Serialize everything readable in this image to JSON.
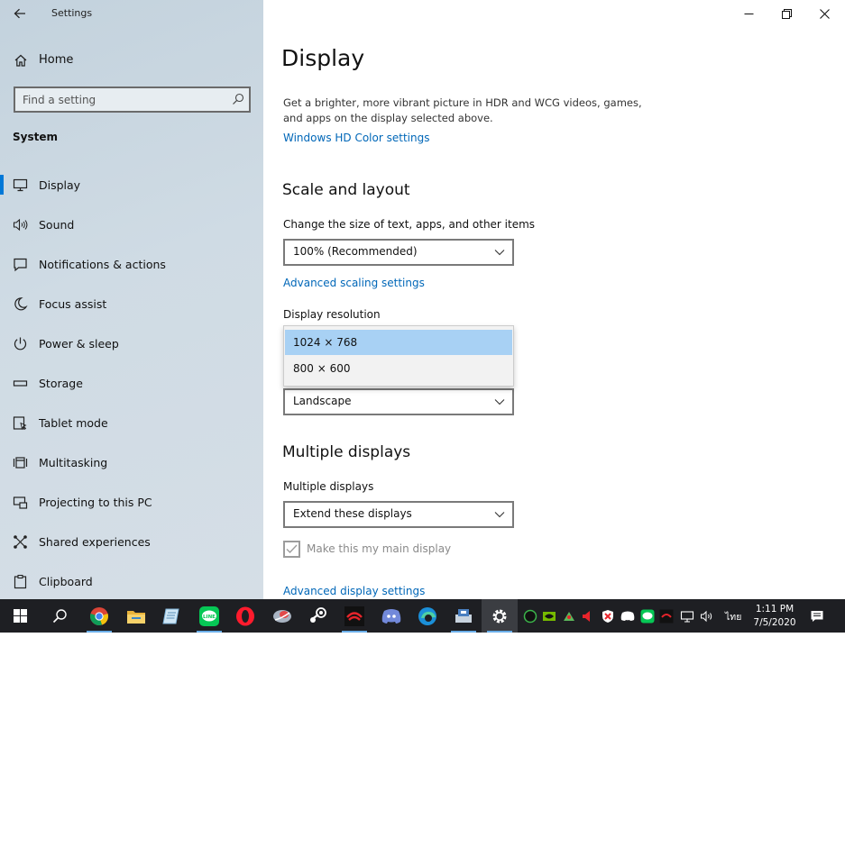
{
  "window": {
    "title": "Settings",
    "controls": [
      "minimize",
      "restore",
      "close"
    ]
  },
  "sidebar": {
    "home_label": "Home",
    "search_placeholder": "Find a setting",
    "section_label": "System",
    "items": [
      {
        "label": "Display",
        "icon": "monitor-icon",
        "active": true
      },
      {
        "label": "Sound",
        "icon": "speaker-icon"
      },
      {
        "label": "Notifications & actions",
        "icon": "notification-icon"
      },
      {
        "label": "Focus assist",
        "icon": "moon-icon"
      },
      {
        "label": "Power & sleep",
        "icon": "power-icon"
      },
      {
        "label": "Storage",
        "icon": "storage-icon"
      },
      {
        "label": "Tablet mode",
        "icon": "tablet-icon"
      },
      {
        "label": "Multitasking",
        "icon": "multitasking-icon"
      },
      {
        "label": "Projecting to this PC",
        "icon": "projector-icon"
      },
      {
        "label": "Shared experiences",
        "icon": "shared-icon"
      },
      {
        "label": "Clipboard",
        "icon": "clipboard-icon"
      }
    ]
  },
  "main": {
    "page_title": "Display",
    "hdr_description": "Get a brighter, more vibrant picture in HDR and WCG videos, games, and apps on the display selected above.",
    "hdr_link": "Windows HD Color settings",
    "scale_heading": "Scale and layout",
    "scale_label": "Change the size of text, apps, and other items",
    "scale_value": "100% (Recommended)",
    "advanced_scaling_link": "Advanced scaling settings",
    "resolution_label": "Display resolution",
    "resolution_options": [
      {
        "label": "1024 × 768",
        "selected": true
      },
      {
        "label": "800 × 600",
        "selected": false
      }
    ],
    "orientation_value": "Landscape",
    "multiple_heading": "Multiple displays",
    "multiple_label": "Multiple displays",
    "multiple_value": "Extend these displays",
    "main_display_checkbox_label": "Make this my main display",
    "main_display_checked": true,
    "advanced_display_link": "Advanced display settings"
  },
  "taskbar": {
    "apps": [
      "start-icon",
      "search-icon",
      "chrome-icon",
      "file-explorer-icon",
      "notepad-icon",
      "line-icon",
      "opera-icon",
      "app-icon",
      "steam-icon",
      "garena-icon",
      "discord-icon",
      "edge-icon",
      "app-icon",
      "settings-icon"
    ],
    "language": "ไทย",
    "time": "1:11 PM",
    "date": "7/5/2020"
  },
  "colors": {
    "accent": "#0078d7",
    "link": "#0067b8",
    "selected_option": "#a8d1f4",
    "taskbar": "#1e1f23"
  }
}
